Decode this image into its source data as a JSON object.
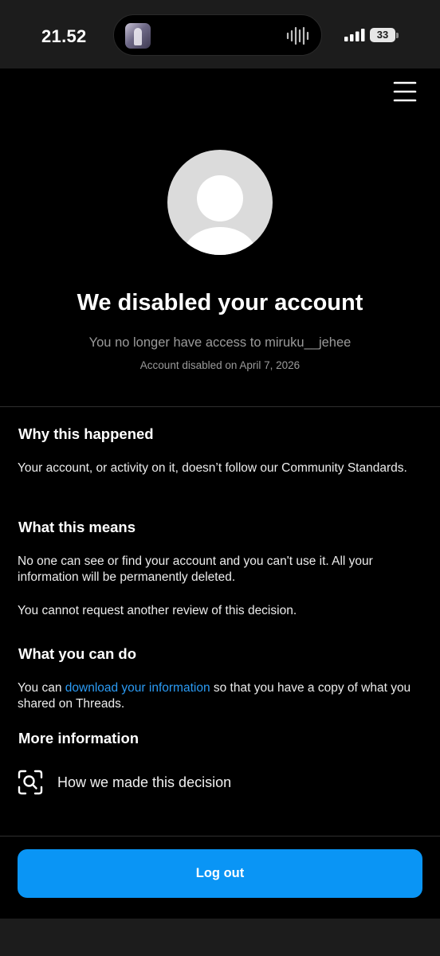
{
  "status_bar": {
    "time": "21.52",
    "battery": "33"
  },
  "icons": {
    "menu": "hamburger-menu-icon",
    "avatar": "default-avatar-icon",
    "decision": "magnifier-scan-icon"
  },
  "header": {
    "title": "We disabled your account",
    "subtitle": "You no longer have access to miruku__jehee",
    "disabled_date": "Account disabled on April 7, 2026"
  },
  "sections": {
    "why": {
      "heading": "Why this happened",
      "body": "Your account, or activity on it, doesn’t follow our Community Standards."
    },
    "means": {
      "heading": "What this means",
      "body1": "No one can see or find your account and you can't use it. All your information will be permanently deleted.",
      "body2": "You cannot request another review of this decision."
    },
    "can_do": {
      "heading": "What you can do",
      "body_prefix": "You can ",
      "link_text": "download your information",
      "body_suffix": " so that you have a copy of what you shared on Threads."
    },
    "more": {
      "heading": "More information",
      "decision_label": "How we made this decision"
    }
  },
  "footer": {
    "logout_label": "Log out"
  },
  "colors": {
    "background": "#000000",
    "accent": "#0a95f5",
    "link": "#2b9bf4",
    "muted_text": "#9a9a9a"
  }
}
